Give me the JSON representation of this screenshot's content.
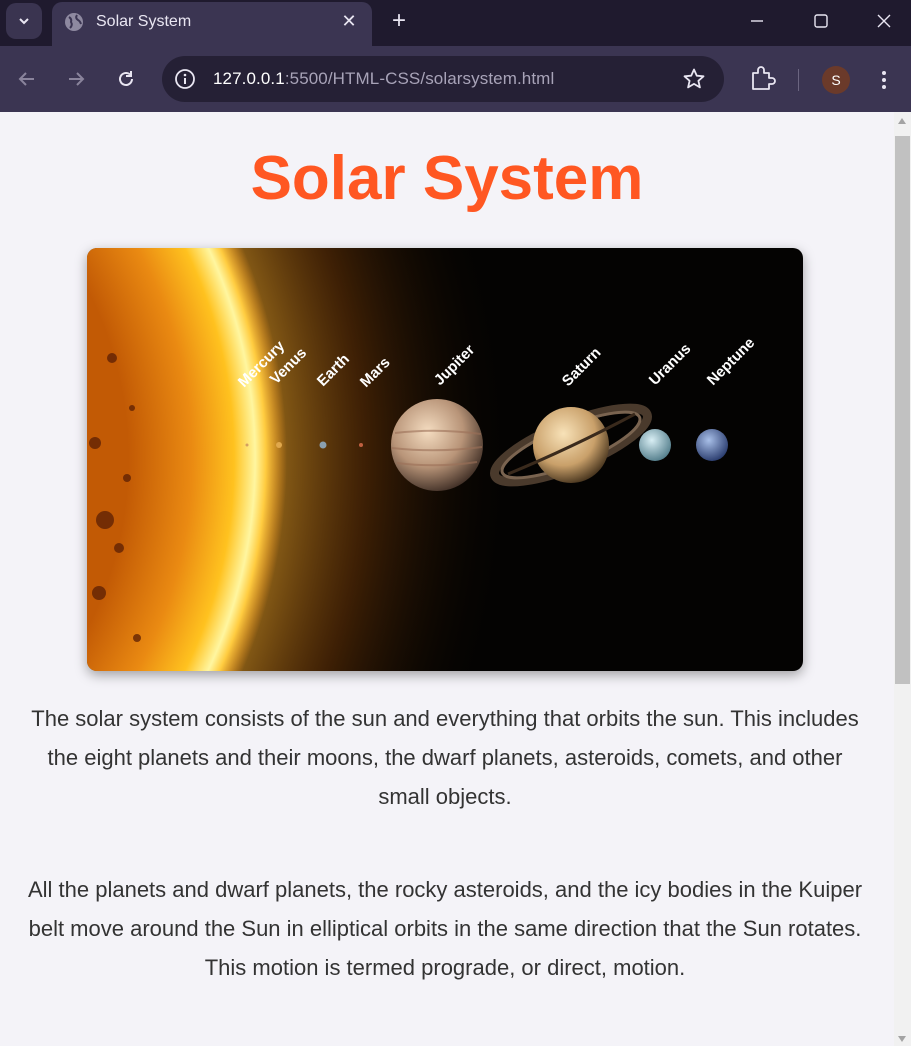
{
  "browser": {
    "tab_title": "Solar System",
    "url_host": "127.0.0.1",
    "url_rest": ":5500/HTML-CSS/solarsystem.html",
    "profile_initial": "S"
  },
  "page": {
    "heading": "Solar System",
    "heading_color": "#ff5722",
    "image": {
      "planet_labels": [
        "Mercury",
        "Venus",
        "Earth",
        "Mars",
        "Jupiter",
        "Saturn",
        "Uranus",
        "Neptune"
      ]
    },
    "paragraphs": [
      "The solar system consists of the sun and everything that orbits the sun. This includes the eight planets and their moons, the dwarf planets, asteroids, comets, and other small objects.",
      "All the planets and dwarf planets, the rocky asteroids, and the icy bodies in the Kuiper belt move around the Sun in elliptical orbits in the same direction that the Sun rotates. This motion is termed prograde, or direct, motion."
    ]
  }
}
